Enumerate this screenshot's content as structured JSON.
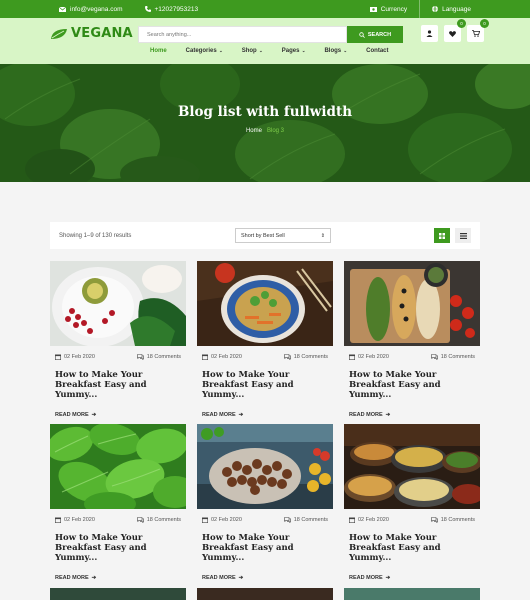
{
  "topbar": {
    "email": "info@vegana.com",
    "phone": "+12027953213",
    "currency": "Currency",
    "language": "Language"
  },
  "brand": {
    "name": "VEGANA",
    "color": "#3e9a1f"
  },
  "search": {
    "placeholder": "Search anything...",
    "button": "SEARCH"
  },
  "header_icons": {
    "wishlist_count": "0",
    "cart_count": "0"
  },
  "nav": {
    "home": "Home",
    "categories": "Categories",
    "shop": "Shop",
    "pages": "Pages",
    "blogs": "Blogs",
    "contact": "Contact"
  },
  "hero": {
    "title": "Blog list with fullwidth",
    "crumb_home": "Home",
    "crumb_current": "Blog 3"
  },
  "toolbar": {
    "results": "Showing 1–9 of 130 results",
    "sort": "Short by Best Sell"
  },
  "posts": [
    {
      "date": "02 Feb 2020",
      "comments": "18 Comments",
      "title": "How to Make Your Breakfast Easy and Yummy...",
      "more": "READ MORE",
      "image": "pomegranate-plate"
    },
    {
      "date": "02 Feb 2020",
      "comments": "18 Comments",
      "title": "How to Make Your Breakfast Easy and Yummy...",
      "more": "READ MORE",
      "image": "vegetable-noodle-bowl"
    },
    {
      "date": "02 Feb 2020",
      "comments": "18 Comments",
      "title": "How to Make Your Breakfast Easy and Yummy...",
      "more": "READ MORE",
      "image": "toast-platter"
    },
    {
      "date": "02 Feb 2020",
      "comments": "18 Comments",
      "title": "How to Make Your Breakfast Easy and Yummy...",
      "more": "READ MORE",
      "image": "spinach-leaves"
    },
    {
      "date": "02 Feb 2020",
      "comments": "18 Comments",
      "title": "How to Make Your Breakfast Easy and Yummy...",
      "more": "READ MORE",
      "image": "chestnut-market"
    },
    {
      "date": "02 Feb 2020",
      "comments": "18 Comments",
      "title": "How to Make Your Breakfast Easy and Yummy...",
      "more": "READ MORE",
      "image": "food-bowls"
    }
  ]
}
